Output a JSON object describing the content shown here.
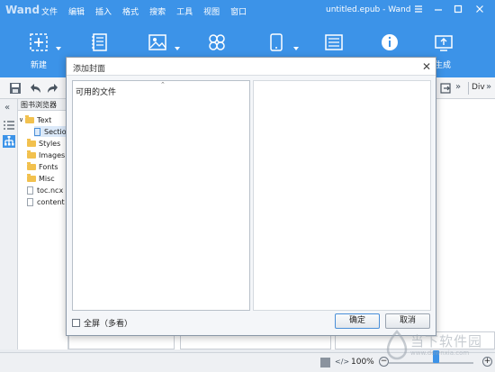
{
  "app": {
    "logo": "Wand",
    "document_title": "untitled.epub - Wand"
  },
  "menu": [
    "文件",
    "编辑",
    "插入",
    "格式",
    "搜索",
    "工具",
    "视图",
    "窗口"
  ],
  "ribbon": {
    "new_label": "新建",
    "generate_label": "生成"
  },
  "toolbar": {
    "div_label": "Div"
  },
  "book_browser": {
    "title": "图书浏览器",
    "items": [
      {
        "label": "Text",
        "type": "folder"
      },
      {
        "label": "Section",
        "type": "file"
      },
      {
        "label": "Styles",
        "type": "folder"
      },
      {
        "label": "Images",
        "type": "folder"
      },
      {
        "label": "Fonts",
        "type": "folder"
      },
      {
        "label": "Misc",
        "type": "folder"
      },
      {
        "label": "toc.ncx",
        "type": "file"
      },
      {
        "label": "content",
        "type": "file"
      }
    ]
  },
  "status": {
    "zoom": "100%"
  },
  "dialog": {
    "title": "添加封面",
    "list_header": "可用的文件",
    "fullscreen_label": "全屏（多看）",
    "ok_label": "确定",
    "cancel_label": "取消"
  },
  "watermark": {
    "text": "当下软件园",
    "sub": "www.downxia.com"
  },
  "colors": {
    "brand": "#3c93e8",
    "folder": "#f2c14e"
  }
}
